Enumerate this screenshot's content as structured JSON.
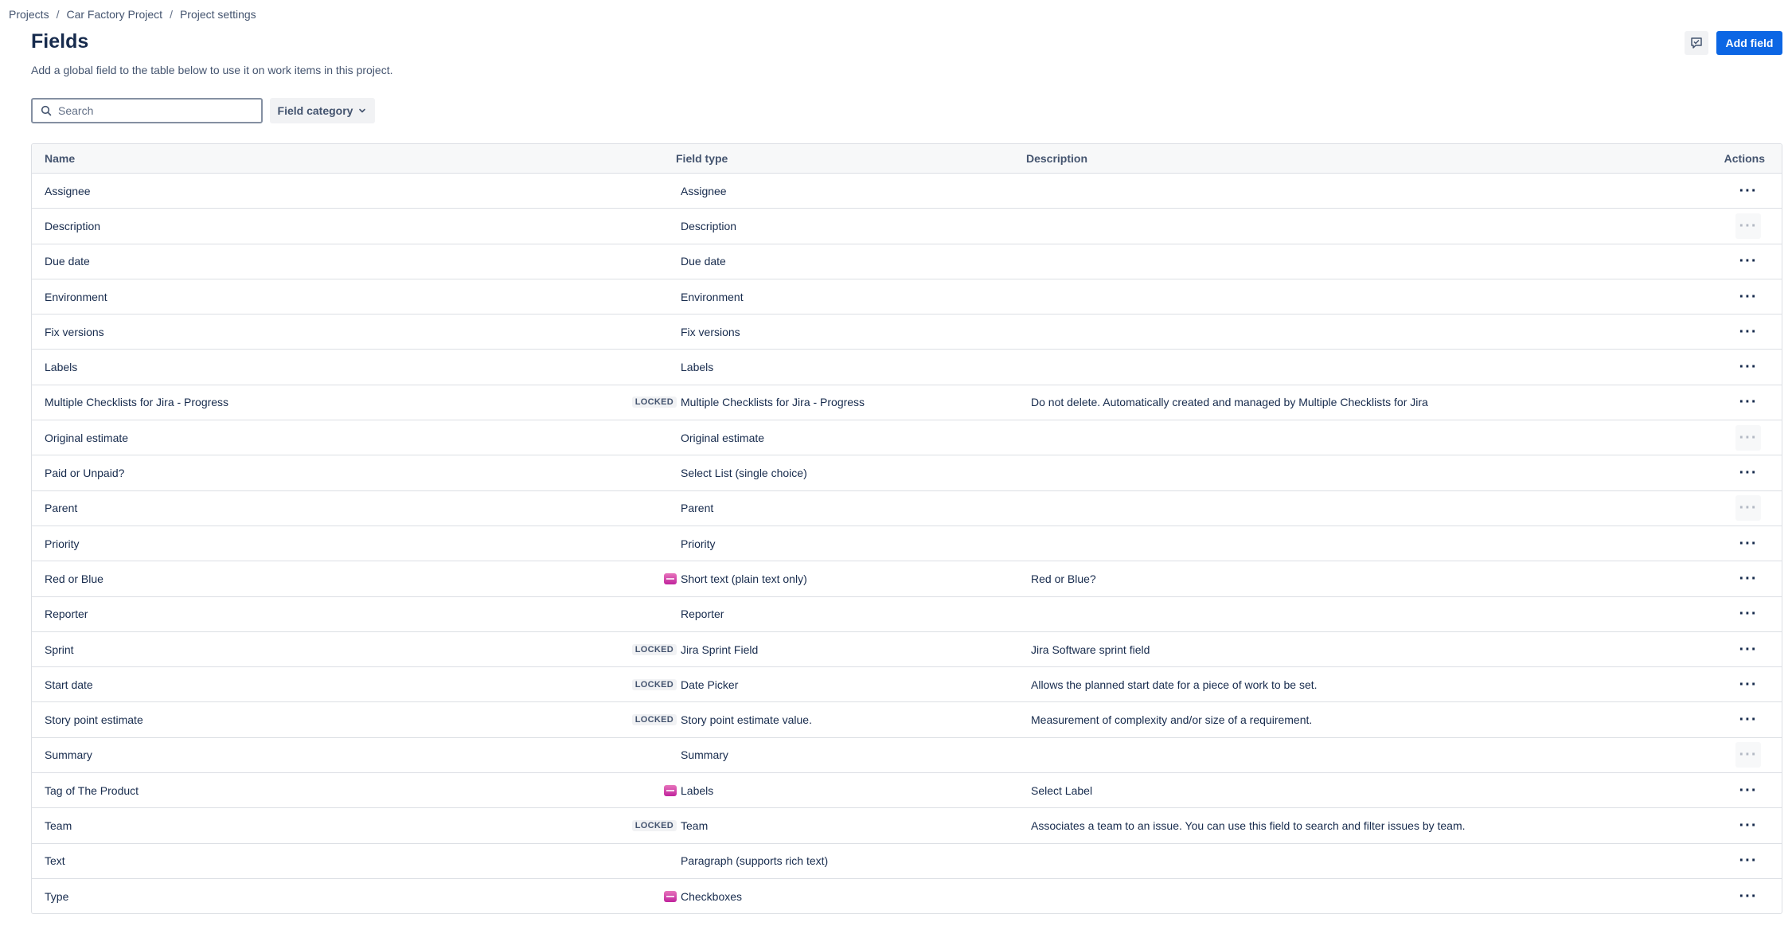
{
  "breadcrumb": [
    "Projects",
    "Car Factory Project",
    "Project settings"
  ],
  "page": {
    "title": "Fields",
    "subtitle": "Add a global field to the table below to use it on work items in this project."
  },
  "toolbar": {
    "add_field_label": "Add field",
    "feedback_icon": "feedback-icon"
  },
  "filters": {
    "search_placeholder": "Search",
    "field_category_label": "Field category"
  },
  "table": {
    "columns": [
      "Name",
      "Field type",
      "Description",
      "Actions"
    ],
    "rows": [
      {
        "name": "Assignee",
        "badge": "",
        "type": "Assignee",
        "description": "",
        "actions_disabled": false
      },
      {
        "name": "Description",
        "badge": "",
        "type": "Description",
        "description": "",
        "actions_disabled": true
      },
      {
        "name": "Due date",
        "badge": "",
        "type": "Due date",
        "description": "",
        "actions_disabled": false
      },
      {
        "name": "Environment",
        "badge": "",
        "type": "Environment",
        "description": "",
        "actions_disabled": false
      },
      {
        "name": "Fix versions",
        "badge": "",
        "type": "Fix versions",
        "description": "",
        "actions_disabled": false
      },
      {
        "name": "Labels",
        "badge": "",
        "type": "Labels",
        "description": "",
        "actions_disabled": false
      },
      {
        "name": "Multiple Checklists for Jira - Progress",
        "badge": "LOCKED",
        "type": "Multiple Checklists for Jira - Progress",
        "description": "Do not delete. Automatically created and managed by Multiple Checklists for Jira",
        "actions_disabled": false
      },
      {
        "name": "Original estimate",
        "badge": "",
        "type": "Original estimate",
        "description": "",
        "actions_disabled": true
      },
      {
        "name": "Paid or Unpaid?",
        "badge": "",
        "type": "Select List (single choice)",
        "description": "",
        "actions_disabled": false
      },
      {
        "name": "Parent",
        "badge": "",
        "type": "Parent",
        "description": "",
        "actions_disabled": true
      },
      {
        "name": "Priority",
        "badge": "",
        "type": "Priority",
        "description": "",
        "actions_disabled": false
      },
      {
        "name": "Red or Blue",
        "badge": "app-icon",
        "type": "Short text (plain text only)",
        "description": "Red or Blue?",
        "actions_disabled": false
      },
      {
        "name": "Reporter",
        "badge": "",
        "type": "Reporter",
        "description": "",
        "actions_disabled": false
      },
      {
        "name": "Sprint",
        "badge": "LOCKED",
        "type": "Jira Sprint Field",
        "description": "Jira Software sprint field",
        "actions_disabled": false
      },
      {
        "name": "Start date",
        "badge": "LOCKED",
        "type": "Date Picker",
        "description": "Allows the planned start date for a piece of work to be set.",
        "actions_disabled": false
      },
      {
        "name": "Story point estimate",
        "badge": "LOCKED",
        "type": "Story point estimate value.",
        "description": "Measurement of complexity and/or size of a requirement.",
        "actions_disabled": false
      },
      {
        "name": "Summary",
        "badge": "",
        "type": "Summary",
        "description": "",
        "actions_disabled": true
      },
      {
        "name": "Tag of The Product",
        "badge": "app-icon",
        "type": "Labels",
        "description": "Select Label",
        "actions_disabled": false
      },
      {
        "name": "Team",
        "badge": "LOCKED",
        "type": "Team",
        "description": "Associates a team to an issue. You can use this field to search and filter issues by team.",
        "actions_disabled": false
      },
      {
        "name": "Text",
        "badge": "",
        "type": "Paragraph (supports rich text)",
        "description": "",
        "actions_disabled": false
      },
      {
        "name": "Type",
        "badge": "app-icon",
        "type": "Checkboxes",
        "description": "",
        "actions_disabled": false
      }
    ]
  }
}
